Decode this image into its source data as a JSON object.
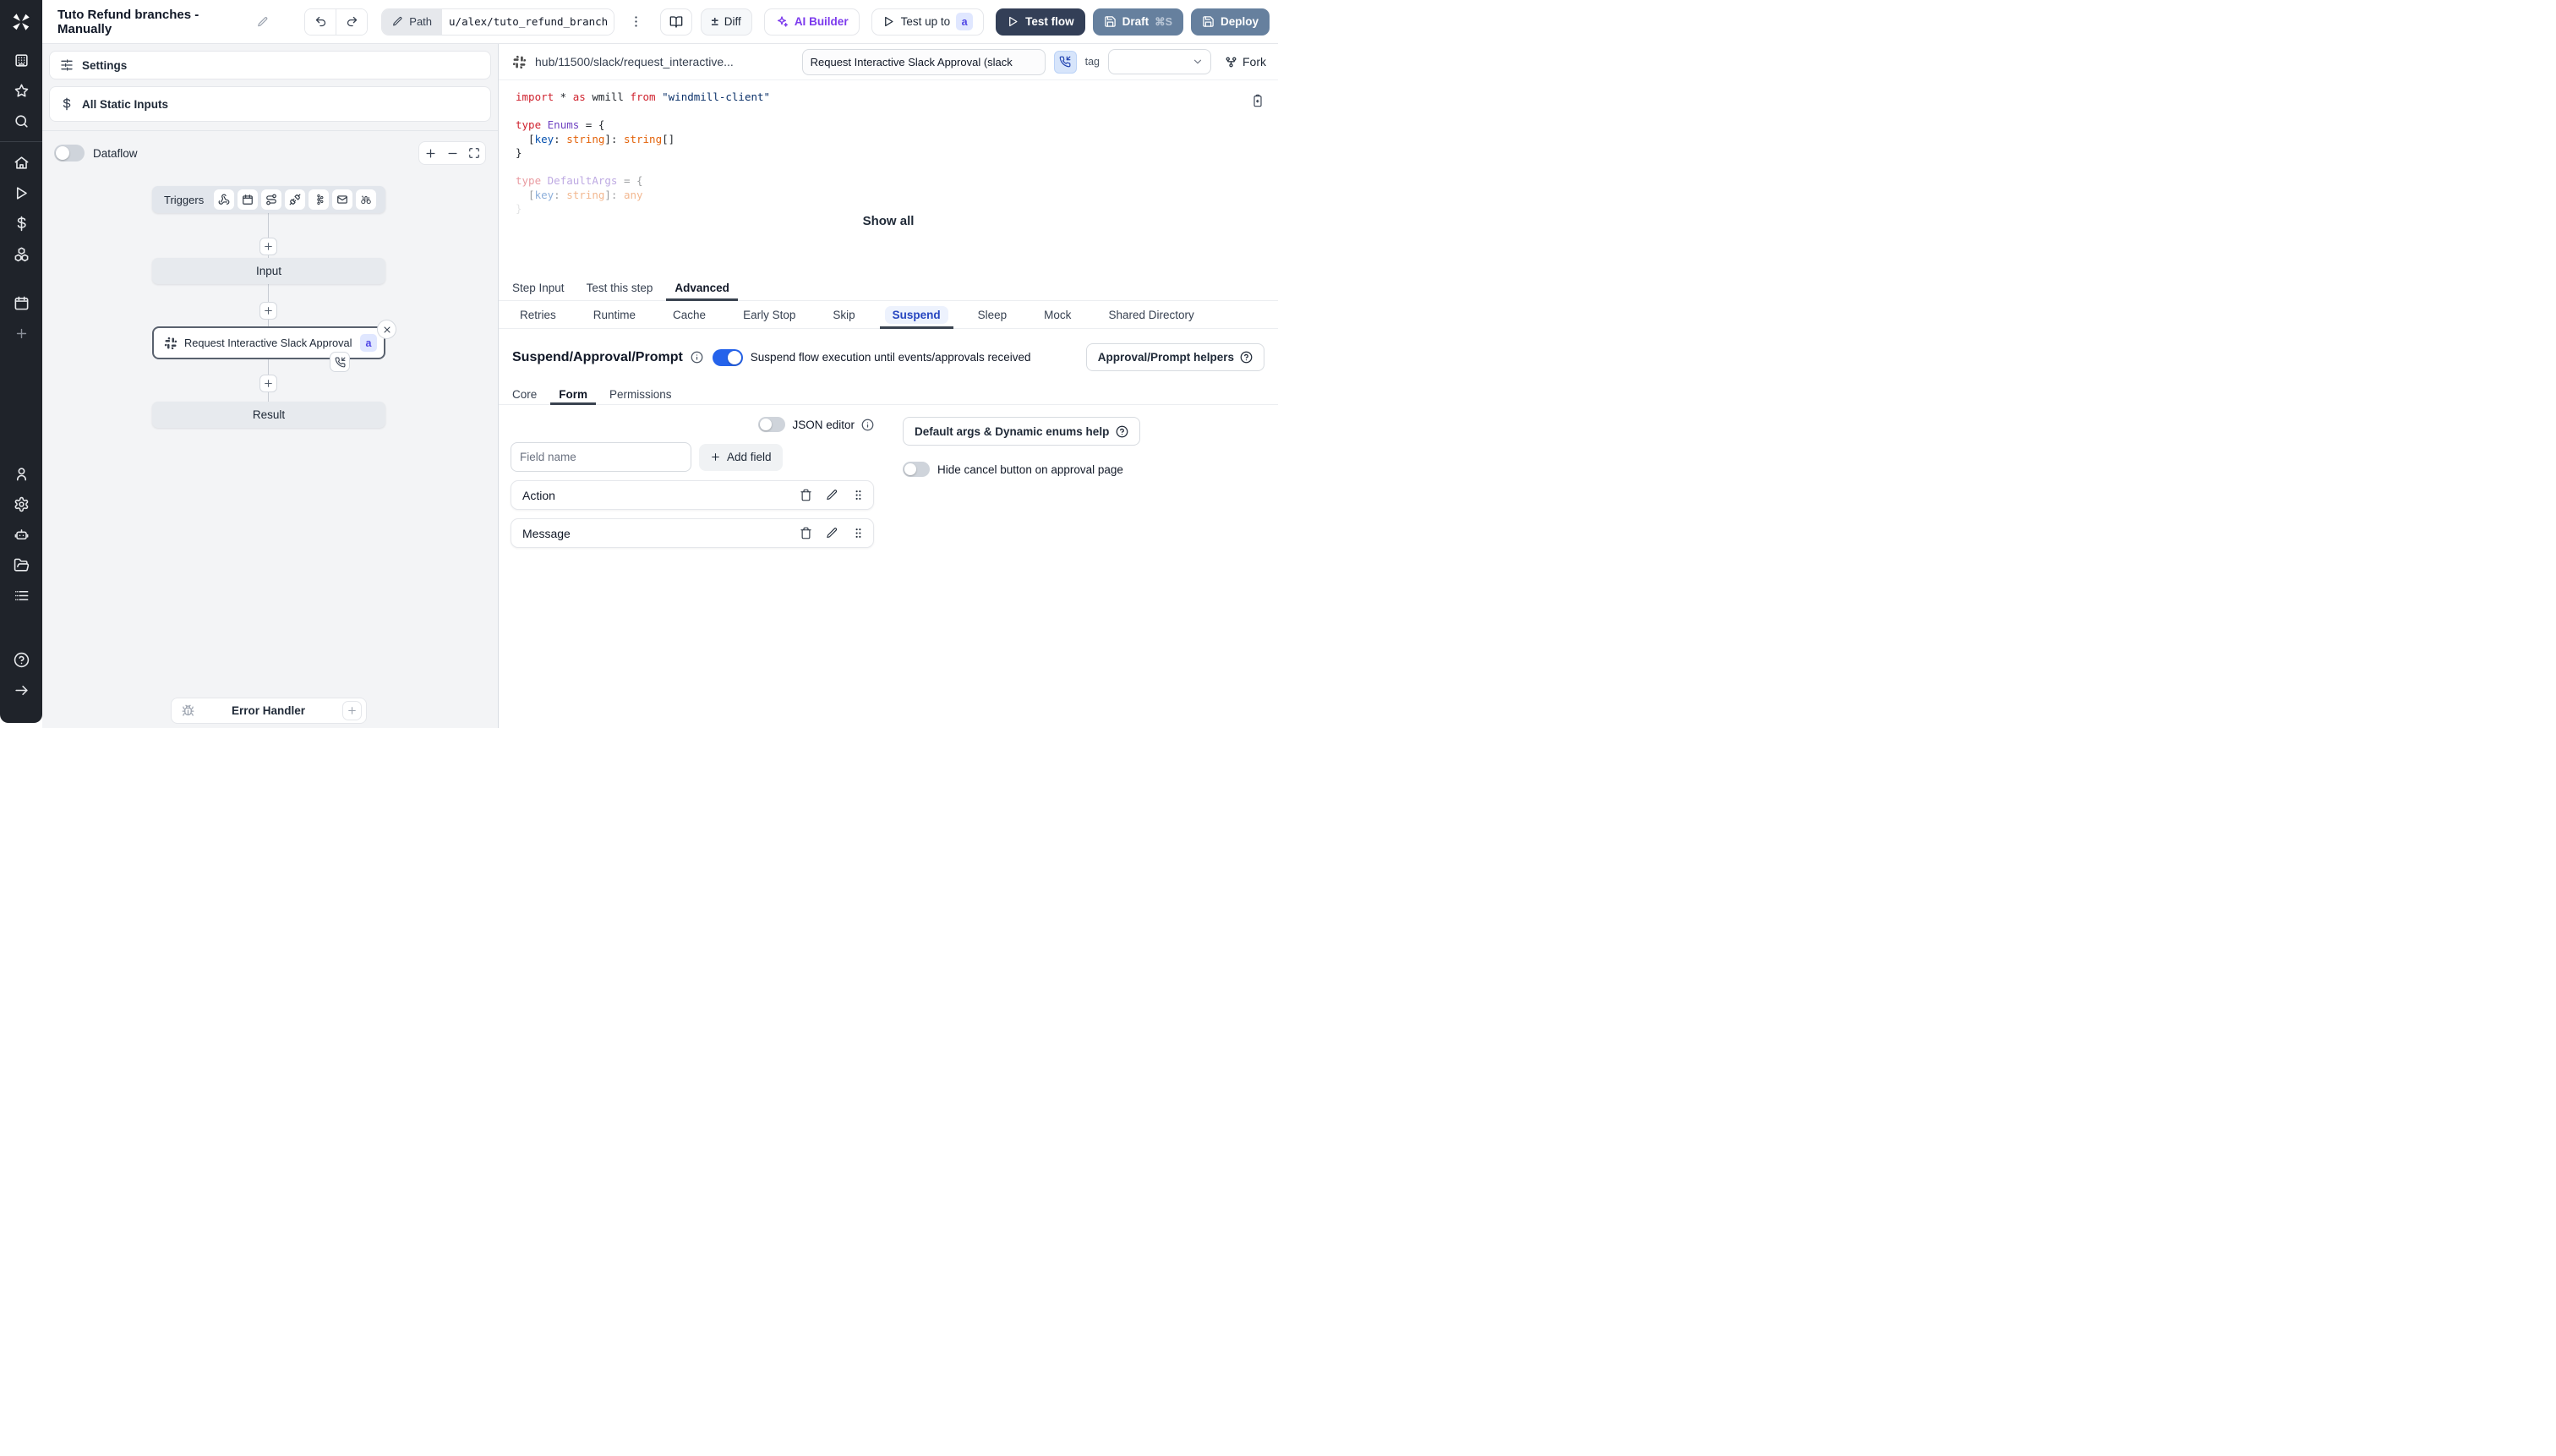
{
  "colors": {
    "accent": "#2563eb",
    "accent-strong": "#2746c0",
    "navy": "#333f57",
    "slate": "#66809e",
    "purple": "#7c3aed",
    "kw": "#cf222e",
    "typ": "#6f42c1",
    "prop": "#0550ae",
    "orange": "#e36209",
    "str": "#0a3069"
  },
  "topbar": {
    "title": "Tuto Refund branches - Manually",
    "path_label": "Path",
    "path_value": "u/alex/tuto_refund_branches__",
    "diff_label": "Diff",
    "plus_minus": "±",
    "ai_builder_label": "AI Builder",
    "test_up_to_label": "Test up to",
    "test_up_to_badge": "a",
    "test_flow_label": "Test flow",
    "draft_label": "Draft",
    "draft_shortcut": "⌘S",
    "deploy_label": "Deploy"
  },
  "flow": {
    "settings_label": "Settings",
    "static_inputs_label": "All Static Inputs",
    "dataflow_label": "Dataflow",
    "triggers_label": "Triggers",
    "nodes": {
      "input": "Input",
      "step": "Request Interactive Slack Approval (...",
      "step_badge": "a",
      "result": "Result"
    },
    "error_handler": "Error Handler"
  },
  "script_header": {
    "hub_path": "hub/11500/slack/request_interactive...",
    "name_value": "Request Interactive Slack Approval (slack",
    "tag_label": "tag",
    "fork_label": "Fork"
  },
  "editor": {
    "show_all": "Show all",
    "lines": [
      {
        "fade": 0,
        "tokens": [
          {
            "t": "import",
            "c": "kw"
          },
          {
            "t": " * ",
            "c": "pl"
          },
          {
            "t": "as",
            "c": "kw"
          },
          {
            "t": " wmill ",
            "c": "pl"
          },
          {
            "t": "from",
            "c": "kw"
          },
          {
            "t": " ",
            "c": "pl"
          },
          {
            "t": "\"windmill-client\"",
            "c": "str"
          }
        ]
      },
      {
        "fade": 0,
        "tokens": []
      },
      {
        "fade": 0,
        "tokens": [
          {
            "t": "type",
            "c": "kw"
          },
          {
            "t": " ",
            "c": "pl"
          },
          {
            "t": "Enums",
            "c": "typ"
          },
          {
            "t": " = {",
            "c": "pl"
          }
        ]
      },
      {
        "fade": 0,
        "tokens": [
          {
            "t": "  [",
            "c": "pl"
          },
          {
            "t": "key",
            "c": "prop"
          },
          {
            "t": ": ",
            "c": "pl"
          },
          {
            "t": "string",
            "c": "orange"
          },
          {
            "t": "]: ",
            "c": "pl"
          },
          {
            "t": "string",
            "c": "orange"
          },
          {
            "t": "[]",
            "c": "pl"
          }
        ]
      },
      {
        "fade": 0,
        "tokens": [
          {
            "t": "}",
            "c": "pl"
          }
        ]
      },
      {
        "fade": 0,
        "tokens": []
      },
      {
        "fade": 1,
        "tokens": [
          {
            "t": "type",
            "c": "kw"
          },
          {
            "t": " ",
            "c": "pl"
          },
          {
            "t": "DefaultArgs",
            "c": "typ"
          },
          {
            "t": " = {",
            "c": "pl"
          }
        ]
      },
      {
        "fade": 1,
        "tokens": [
          {
            "t": "  [",
            "c": "pl"
          },
          {
            "t": "key",
            "c": "prop"
          },
          {
            "t": ": ",
            "c": "pl"
          },
          {
            "t": "string",
            "c": "orange"
          },
          {
            "t": "]: ",
            "c": "pl"
          },
          {
            "t": "any",
            "c": "orange"
          }
        ]
      },
      {
        "fade": 2,
        "tokens": [
          {
            "t": "}",
            "c": "pl"
          }
        ]
      }
    ]
  },
  "tabs": {
    "step_input": "Step Input",
    "test_this_step": "Test this step",
    "advanced": "Advanced"
  },
  "advanced_tabs": [
    "Retries",
    "Runtime",
    "Cache",
    "Early Stop",
    "Skip",
    "Suspend",
    "Sleep",
    "Mock",
    "Shared Directory"
  ],
  "suspend": {
    "title": "Suspend/Approval/Prompt",
    "description": "Suspend flow execution until events/approvals received",
    "helpers": "Approval/Prompt helpers",
    "core": "Core",
    "form": "Form",
    "permissions": "Permissions",
    "json_editor": "JSON editor",
    "field_placeholder": "Field name",
    "add_field": "Add field",
    "fields": [
      "Action",
      "Message"
    ],
    "default_args_help": "Default args & Dynamic enums help",
    "hide_cancel": "Hide cancel button on approval page"
  }
}
